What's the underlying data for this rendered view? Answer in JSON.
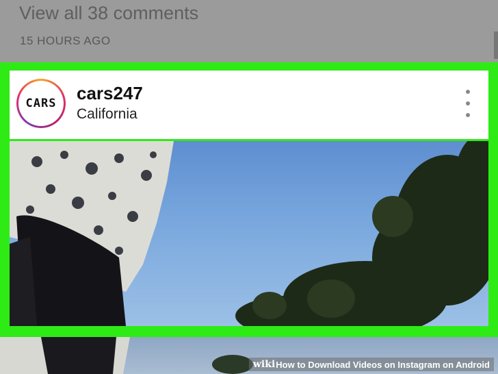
{
  "comments": {
    "view_all_label": "View all 38 comments",
    "time_ago": "15 HOURS AGO"
  },
  "post": {
    "avatar_text": "CARS",
    "username": "cars247",
    "location": "California",
    "menu_icon": "more-vertical-icon"
  },
  "highlight_color": "#2eeb16",
  "watermark": {
    "brand": "wiki",
    "title": "How to Download Videos on Instagram on Android"
  }
}
